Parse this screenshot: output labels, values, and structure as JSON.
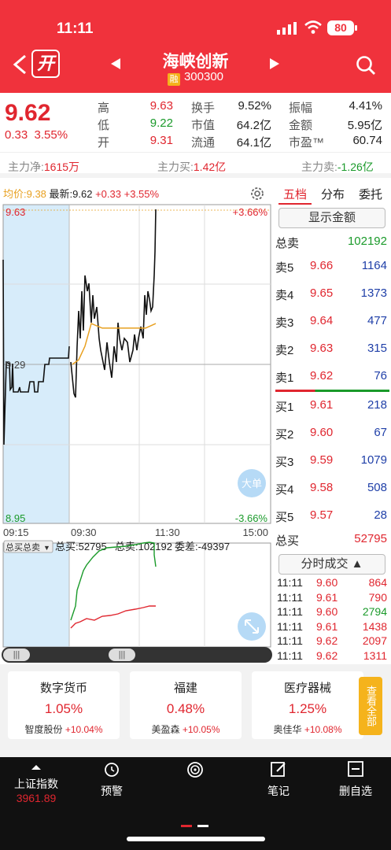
{
  "status": {
    "time": "11:11",
    "battery": "80"
  },
  "header": {
    "kai": "开",
    "name": "海峡创新",
    "rong": "融",
    "code": "300300"
  },
  "quote": {
    "price": "9.62",
    "change": "0.33",
    "change_pct": "3.55%",
    "stats": [
      {
        "label": "高",
        "value": "9.63",
        "color": "red"
      },
      {
        "label": "低",
        "value": "9.22",
        "color": "green"
      },
      {
        "label": "开",
        "value": "9.31",
        "color": "red"
      },
      {
        "label": "换手",
        "value": "9.52%",
        "color": "black"
      },
      {
        "label": "市值",
        "value": "64.2亿",
        "color": "black"
      },
      {
        "label": "流通",
        "value": "64.1亿",
        "color": "black"
      },
      {
        "label": "振幅",
        "value": "4.41%",
        "color": "black"
      },
      {
        "label": "金额",
        "value": "5.95亿",
        "color": "black"
      },
      {
        "label": "市盈™",
        "value": "60.74",
        "color": "black"
      }
    ]
  },
  "flow": {
    "net_label": "主力净:",
    "net_value": "1615万",
    "buy_label": "主力买:",
    "buy_value": "1.42亿",
    "sell_label": "主力卖:",
    "sell_value": "-1.26亿"
  },
  "chart": {
    "avg_label": "均价:9.38",
    "latest_label": "最新:9.62",
    "latest_chg": "+0.33",
    "latest_pct": "+3.55%",
    "y_top": "9.63",
    "y_top_pct": "+3.66%",
    "y_mid": "9.29",
    "y_bot": "8.95",
    "y_bot_pct": "-3.66%",
    "x_ticks": [
      "09:15",
      "09:30",
      "11:30",
      "15:00"
    ],
    "big_order": "大单",
    "sub_select": "总买总卖",
    "sub_buy": "总买:52795",
    "sub_sell": "总卖:102192",
    "sub_diff": "委差:-49397"
  },
  "chart_data": {
    "type": "line",
    "title": "",
    "x": [
      "09:15",
      "09:30",
      "11:30",
      "15:00"
    ],
    "ylim": [
      8.95,
      9.63
    ],
    "prev_close": 9.29,
    "series": [
      {
        "name": "最新",
        "values": [
          9.34,
          9.23,
          9.29,
          9.44,
          9.42,
          9.28,
          9.32,
          9.33,
          9.33,
          9.37,
          9.4,
          9.63
        ]
      },
      {
        "name": "均价",
        "values": [
          9.29,
          9.3,
          9.33,
          9.38,
          9.37,
          9.37,
          9.37,
          9.37,
          9.38
        ]
      }
    ]
  },
  "book": {
    "tabs": [
      "五档",
      "分布",
      "委托"
    ],
    "show_amount": "显示金额",
    "total_sell_label": "总卖",
    "total_sell": "102192",
    "asks": [
      {
        "label": "卖5",
        "price": "9.66",
        "vol": "1164"
      },
      {
        "label": "卖4",
        "price": "9.65",
        "vol": "1373"
      },
      {
        "label": "卖3",
        "price": "9.64",
        "vol": "477"
      },
      {
        "label": "卖2",
        "price": "9.63",
        "vol": "315"
      },
      {
        "label": "卖1",
        "price": "9.62",
        "vol": "76"
      }
    ],
    "bids": [
      {
        "label": "买1",
        "price": "9.61",
        "vol": "218"
      },
      {
        "label": "买2",
        "price": "9.60",
        "vol": "67"
      },
      {
        "label": "买3",
        "price": "9.59",
        "vol": "1079"
      },
      {
        "label": "买4",
        "price": "9.58",
        "vol": "508"
      },
      {
        "label": "买5",
        "price": "9.57",
        "vol": "28"
      }
    ],
    "total_buy_label": "总买",
    "total_buy": "52795",
    "ticks_btn": "分时成交",
    "ticks": [
      {
        "time": "11:11",
        "price": "9.60",
        "vol": "864",
        "color": "red"
      },
      {
        "time": "11:11",
        "price": "9.61",
        "vol": "790",
        "color": "red"
      },
      {
        "time": "11:11",
        "price": "9.60",
        "vol": "2794",
        "color": "green"
      },
      {
        "time": "11:11",
        "price": "9.61",
        "vol": "1438",
        "color": "red"
      },
      {
        "time": "11:11",
        "price": "9.62",
        "vol": "2097",
        "color": "red"
      },
      {
        "time": "11:11",
        "price": "9.62",
        "vol": "1311",
        "color": "red"
      }
    ]
  },
  "sectors": [
    {
      "name": "数字货币",
      "pct": "1.05%",
      "lead": "智度股份",
      "lead_pct": "+10.04%"
    },
    {
      "name": "福建",
      "pct": "0.48%",
      "lead": "美盈森",
      "lead_pct": "+10.05%"
    },
    {
      "name": "医疗器械",
      "pct": "1.25%",
      "lead": "奥佳华",
      "lead_pct": "+10.08%"
    }
  ],
  "see_all": "查看全部",
  "nav": {
    "index_name": "上证指数",
    "index_value": "3961.89",
    "items": [
      "预警",
      "笔记",
      "删自选"
    ]
  },
  "colors": {
    "header": "#f0323c",
    "up": "#e0262f",
    "down": "#1a9a2a",
    "avg": "#e8a020"
  }
}
